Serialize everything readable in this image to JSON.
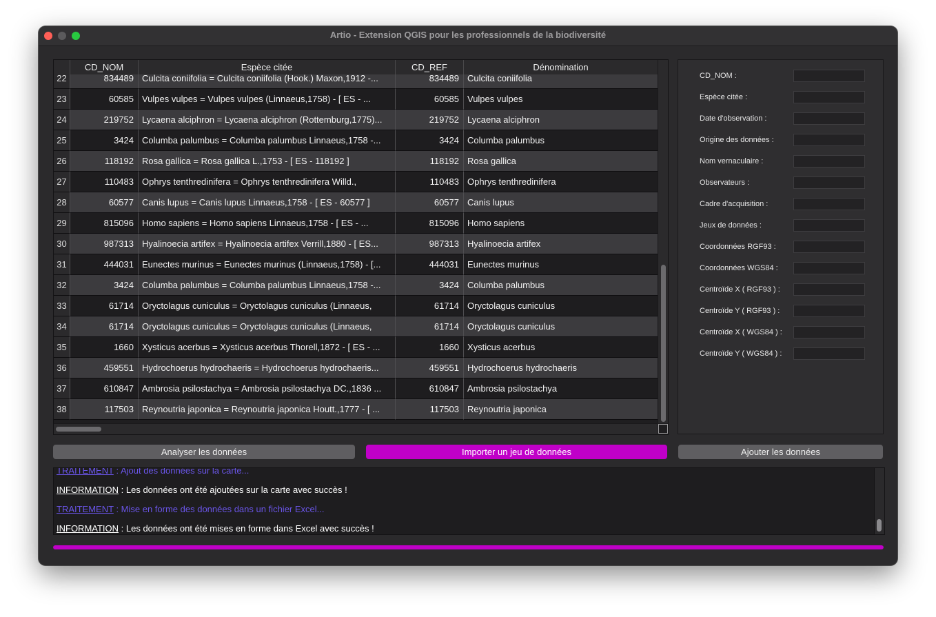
{
  "window": {
    "title": "Artio - Extension QGIS pour les professionnels de la biodiversité"
  },
  "table": {
    "columns": [
      "CD_NOM",
      "Espèce citée",
      "CD_REF",
      "Dénomination"
    ],
    "rows": [
      {
        "idx": "22",
        "cd_nom": "834489",
        "espece": "Culcita coniifolia = Culcita coniifolia (Hook.) Maxon,1912 -...",
        "cd_ref": "834489",
        "denom": "Culcita coniifolia"
      },
      {
        "idx": "23",
        "cd_nom": "60585",
        "espece": "Vulpes vulpes = Vulpes vulpes (Linnaeus,1758) - [ ES - ...",
        "cd_ref": "60585",
        "denom": "Vulpes vulpes"
      },
      {
        "idx": "24",
        "cd_nom": "219752",
        "espece": "Lycaena alciphron = Lycaena alciphron (Rottemburg,1775)...",
        "cd_ref": "219752",
        "denom": "Lycaena alciphron"
      },
      {
        "idx": "25",
        "cd_nom": "3424",
        "espece": "Columba palumbus = Columba palumbus Linnaeus,1758 -...",
        "cd_ref": "3424",
        "denom": "Columba palumbus"
      },
      {
        "idx": "26",
        "cd_nom": "118192",
        "espece": "Rosa gallica = Rosa gallica L.,1753 - [ ES - 118192 ]",
        "cd_ref": "118192",
        "denom": "Rosa gallica"
      },
      {
        "idx": "27",
        "cd_nom": "110483",
        "espece": "Ophrys tenthredinifera = Ophrys tenthredinifera Willd.,",
        "cd_ref": "110483",
        "denom": "Ophrys tenthredinifera"
      },
      {
        "idx": "28",
        "cd_nom": "60577",
        "espece": "Canis lupus = Canis lupus Linnaeus,1758 - [ ES - 60577 ]",
        "cd_ref": "60577",
        "denom": "Canis lupus"
      },
      {
        "idx": "29",
        "cd_nom": "815096",
        "espece": "Homo sapiens = Homo sapiens Linnaeus,1758 - [ ES - ...",
        "cd_ref": "815096",
        "denom": "Homo sapiens"
      },
      {
        "idx": "30",
        "cd_nom": "987313",
        "espece": "Hyalinoecia artifex = Hyalinoecia artifex Verrill,1880 - [ ES...",
        "cd_ref": "987313",
        "denom": "Hyalinoecia artifex"
      },
      {
        "idx": "31",
        "cd_nom": "444031",
        "espece": "Eunectes murinus = Eunectes murinus (Linnaeus,1758) - [...",
        "cd_ref": "444031",
        "denom": "Eunectes murinus"
      },
      {
        "idx": "32",
        "cd_nom": "3424",
        "espece": "Columba palumbus = Columba palumbus Linnaeus,1758 -...",
        "cd_ref": "3424",
        "denom": "Columba palumbus"
      },
      {
        "idx": "33",
        "cd_nom": "61714",
        "espece": "Oryctolagus cuniculus = Oryctolagus cuniculus (Linnaeus,",
        "cd_ref": "61714",
        "denom": "Oryctolagus cuniculus"
      },
      {
        "idx": "34",
        "cd_nom": "61714",
        "espece": "Oryctolagus cuniculus = Oryctolagus cuniculus (Linnaeus,",
        "cd_ref": "61714",
        "denom": "Oryctolagus cuniculus"
      },
      {
        "idx": "35",
        "cd_nom": "1660",
        "espece": "Xysticus acerbus = Xysticus acerbus Thorell,1872 - [ ES - ...",
        "cd_ref": "1660",
        "denom": "Xysticus acerbus"
      },
      {
        "idx": "36",
        "cd_nom": "459551",
        "espece": "Hydrochoerus hydrochaeris = Hydrochoerus hydrochaeris...",
        "cd_ref": "459551",
        "denom": "Hydrochoerus hydrochaeris"
      },
      {
        "idx": "37",
        "cd_nom": "610847",
        "espece": "Ambrosia psilostachya = Ambrosia psilostachya DC.,1836 ...",
        "cd_ref": "610847",
        "denom": "Ambrosia psilostachya"
      },
      {
        "idx": "38",
        "cd_nom": "117503",
        "espece": "Reynoutria japonica = Reynoutria japonica Houtt.,1777 - [ ...",
        "cd_ref": "117503",
        "denom": "Reynoutria japonica"
      }
    ]
  },
  "form": {
    "fields": [
      "CD_NOM :",
      "Espèce citée :",
      "Date d'observation :",
      "Origine des données :",
      "Nom vernaculaire :",
      "Observateurs :",
      "Cadre d'acquisition :",
      "Jeux de données :",
      "Coordonnées RGF93 :",
      "Coordonnées WGS84 :",
      "Centroïde X ( RGF93 ) :",
      "Centroïde Y ( RGF93 ) :",
      "Centroïde X ( WGS84 ) :",
      "Centroïde Y ( WGS84 ) :"
    ]
  },
  "buttons": {
    "analyse": "Analyser les données",
    "import": "Importer un jeu de données",
    "ajout": "Ajouter les données"
  },
  "log": {
    "lines": [
      {
        "type": "trait",
        "keyword": "TRAITEMENT",
        "text": " : Ajout des données sur la carte..."
      },
      {
        "type": "info",
        "keyword": "INFORMATION",
        "text": " : Les données ont été ajoutées sur la carte avec succès !"
      },
      {
        "type": "trait",
        "keyword": "TRAITEMENT",
        "text": " : Mise en forme des données dans un fichier Excel..."
      },
      {
        "type": "info",
        "keyword": "INFORMATION",
        "text": " : Les données ont été mises en forme dans Excel avec succès !"
      }
    ]
  },
  "progress": {
    "percent": 100
  },
  "colors": {
    "accent": "#c000c8",
    "traitement": "#6a55e8"
  }
}
